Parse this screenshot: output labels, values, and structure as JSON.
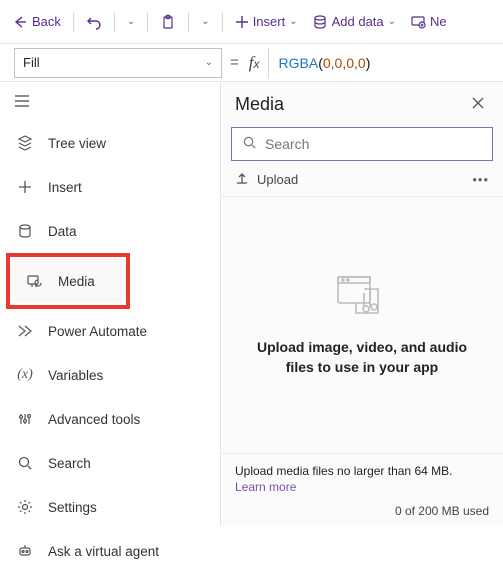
{
  "toolbar": {
    "back": "Back",
    "insert": "Insert",
    "add_data": "Add data",
    "new": "Ne"
  },
  "formula": {
    "property": "Fill",
    "fn": "RGBA",
    "args": [
      "0",
      "0",
      "0",
      "0"
    ]
  },
  "nav": {
    "tree": "Tree view",
    "insert": "Insert",
    "data": "Data",
    "media": "Media",
    "automate": "Power Automate",
    "variables": "Variables",
    "tools": "Advanced tools",
    "search": "Search",
    "settings": "Settings",
    "agent": "Ask a virtual agent"
  },
  "panel": {
    "title": "Media",
    "search_placeholder": "Search",
    "upload": "Upload",
    "empty": "Upload image, video, and audio files to use in your app",
    "footer_note": "Upload media files no larger than 64 MB.",
    "learn_more": "Learn more",
    "usage": "0 of 200 MB used"
  }
}
